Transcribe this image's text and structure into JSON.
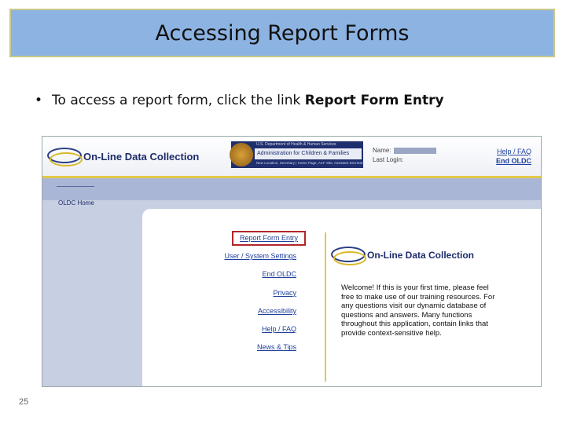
{
  "slide": {
    "title": "Accessing Report Forms",
    "bullet_prefix": "To access a report form, click the link ",
    "bullet_bold": "Report Form Entry",
    "page_number": "25"
  },
  "app": {
    "logo_text": "On-Line Data Collection",
    "agency_line1": "U.S. Department of Health & Human Services",
    "agency_name": "Administration for Children & Families",
    "agency_line3": "New Location, Secretary | Home Page, ACF Site, Assistant Secretary",
    "user_name_label": "Name:",
    "last_login_label": "Last Login:",
    "top_links": {
      "help": "Help / FAQ",
      "end": "End OLDC"
    },
    "sidenav": {
      "home": "OLDC Home"
    },
    "content_links": [
      "Report Form Entry",
      "User / System Settings",
      "End OLDC",
      "Privacy",
      "Accessibility",
      "Help / FAQ",
      "News & Tips"
    ],
    "panel_logo_text": "On-Line Data Collection",
    "welcome": "Welcome! If this is your first time, please feel free to make use of our training resources. For any questions visit our dynamic database of questions and answers. Many functions throughout this application, contain links that provide context-sensitive help."
  }
}
